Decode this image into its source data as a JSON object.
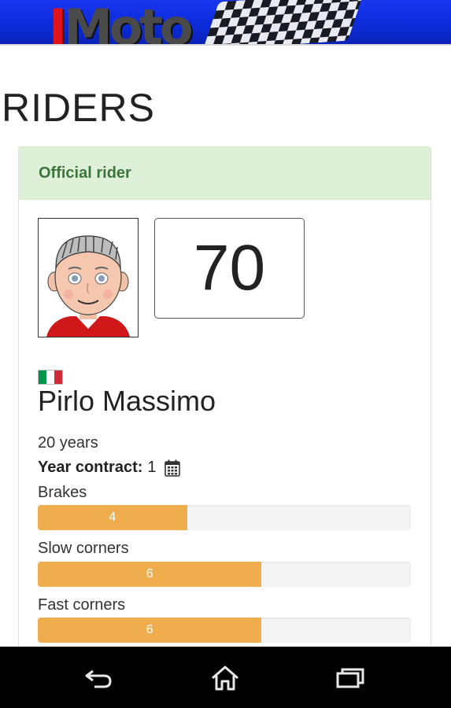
{
  "header": {
    "logo_text_first": "I",
    "logo_text_rest": "Moto",
    "banner_color": "#0a2bd8"
  },
  "page": {
    "title": "RIDERS"
  },
  "rider_panel": {
    "heading": "Official rider",
    "number": "70",
    "flag": "italy-flag-icon",
    "name": "Pirlo Massimo",
    "age": "20 years",
    "contract_label": "Year contract:",
    "contract_value": "1",
    "skills": [
      {
        "label": "Brakes",
        "value": "4",
        "fraction": 0.4
      },
      {
        "label": "Slow corners",
        "value": "6",
        "fraction": 0.6
      },
      {
        "label": "Fast corners",
        "value": "6",
        "fraction": 0.6
      }
    ]
  },
  "colors": {
    "panel_heading_bg": "#dff0d8",
    "panel_heading_text": "#3c763d",
    "bar_fill": "#f0ad4e",
    "bar_track": "#f4f4f4"
  },
  "navbar": {
    "buttons": [
      "back-icon",
      "home-icon",
      "recent-apps-icon"
    ]
  }
}
